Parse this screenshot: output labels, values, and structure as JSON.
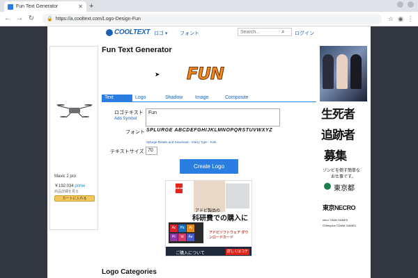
{
  "browser": {
    "tab_title": "Fun Text Generator",
    "new_tab": "+",
    "url": "https://a.cooltext.com/Logo-Design-Fun"
  },
  "site": {
    "logo_text": "COOLTEXT",
    "nav_logo": "ロゴ ▾",
    "nav_font": "フォント",
    "search_placeholder": "Search...",
    "login": "ログイン"
  },
  "ad_left": {
    "product": "Mavic 2 pro",
    "price": "￥192,034",
    "prime": "prime",
    "note": "商品詳細を見る",
    "cart_button": "カートに入れる"
  },
  "main": {
    "title": "Fun Text Generator",
    "preview_text": "FUN",
    "tabs": [
      {
        "label": "Text"
      },
      {
        "label": "Logo"
      },
      {
        "label": "Shadow"
      },
      {
        "label": "Image"
      },
      {
        "label": "Composite"
      }
    ],
    "logo_text_label": "ロゴテキスト",
    "add_symbol": "Add Symbol",
    "logo_text_value": "Fun",
    "font_label": "フォント",
    "font_sample": "SPLURGE ABCDEFGHIJKLMNOPQRSTUVWXYZ",
    "font_credit": "Splurge Details and Download - Vitezy Type - Kids",
    "size_label": "テキストサイズ",
    "size_value": "70",
    "create_button": "Create Logo",
    "categories_heading": "Logo Categories"
  },
  "ad_center": {
    "brand": "Adobe",
    "headline_small": "アドビ製品の",
    "headline_big": "科研費での購入に",
    "promo": "アドビソフトウェア ダウンロードカード",
    "bar_text": "ご購入について",
    "bar_button": "詳しくはコチラ"
  },
  "ad_right": {
    "line1": "生死者",
    "line2": "追跡者",
    "line3": "募集",
    "sub1": "ゾンビを倒す簡単な",
    "sub2": "お仕事です。",
    "tokyo": "東京都",
    "necro": "東京NECRO",
    "credits1": "nitro+ DMM GAMES",
    "credits2": "©Nitroplus ©DMM GAMES"
  },
  "colors": {
    "accent": "#2a7de1",
    "link": "#1d61b5",
    "background": "#31363f"
  }
}
